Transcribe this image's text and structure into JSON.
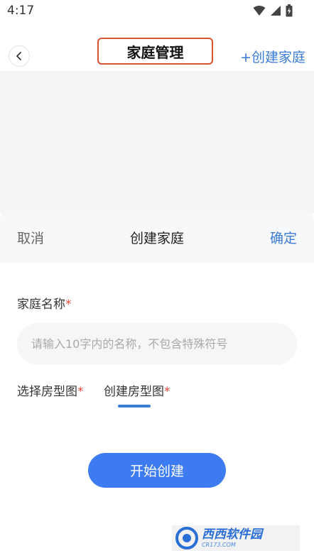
{
  "status_bar": {
    "time": "4:17"
  },
  "header": {
    "title": "家庭管理",
    "create_link": "+创建家庭"
  },
  "sheet": {
    "cancel_label": "取消",
    "title": "创建家庭",
    "confirm_label": "确定",
    "name_label": "家庭名称",
    "required_mark": "*",
    "name_input": {
      "value": "",
      "placeholder": "请输入10字内的名称，不包含特殊符号"
    },
    "tabs": [
      {
        "label": "选择房型图",
        "selected": false
      },
      {
        "label": "创建房型图",
        "selected": true
      }
    ],
    "start_button": "开始创建"
  },
  "watermark": {
    "main": "西西软件园",
    "sub": "CR173.COM"
  },
  "colors": {
    "accent": "#3a7bd5",
    "button": "#3d7cf0",
    "required": "#e64a3b",
    "highlight_border": "#d9532e"
  }
}
